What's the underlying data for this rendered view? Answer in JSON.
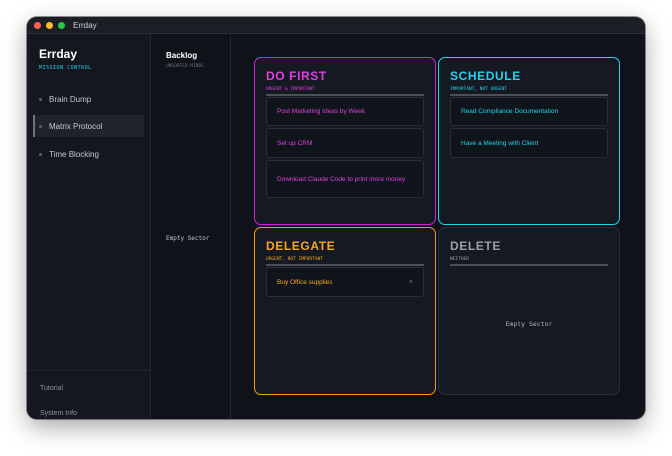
{
  "window": {
    "title": "Errday"
  },
  "sidebar": {
    "app_name": "Errday",
    "subtitle": "MISSION CONTROL",
    "items": [
      {
        "label": "Brain Dump"
      },
      {
        "label": "Matrix Protocol",
        "active": true
      },
      {
        "label": "Time Blocking"
      }
    ],
    "footer": {
      "tutorial": "Tutorial",
      "system_info": "System Info"
    }
  },
  "backlog": {
    "title": "Backlog",
    "subtitle": "UNSORTED MINDS",
    "empty": "Empty Sector"
  },
  "quadrants": {
    "do_first": {
      "title": "DO FIRST",
      "subtitle": "URGENT & IMPORTANT",
      "color": "#e040e0",
      "tasks": [
        "Post Marketing Ideas by Week",
        "Set up CRM",
        "Download Claude Code to print more money"
      ]
    },
    "schedule": {
      "title": "SCHEDULE",
      "subtitle": "IMPORTANT, NOT URGENT",
      "color": "#22d3ee",
      "tasks": [
        "Read Compliance Documentation",
        "Have a Meeting with Client"
      ]
    },
    "delegate": {
      "title": "DELEGATE",
      "subtitle": "URGENT, NOT IMPORTANT",
      "color": "#f5a623",
      "tasks": [
        "Buy Office supplies"
      ],
      "remove_symbol": "×"
    },
    "delete": {
      "title": "DELETE",
      "subtitle": "NEITHER",
      "color": "#9aa0aa",
      "empty": "Empty Sector"
    }
  }
}
